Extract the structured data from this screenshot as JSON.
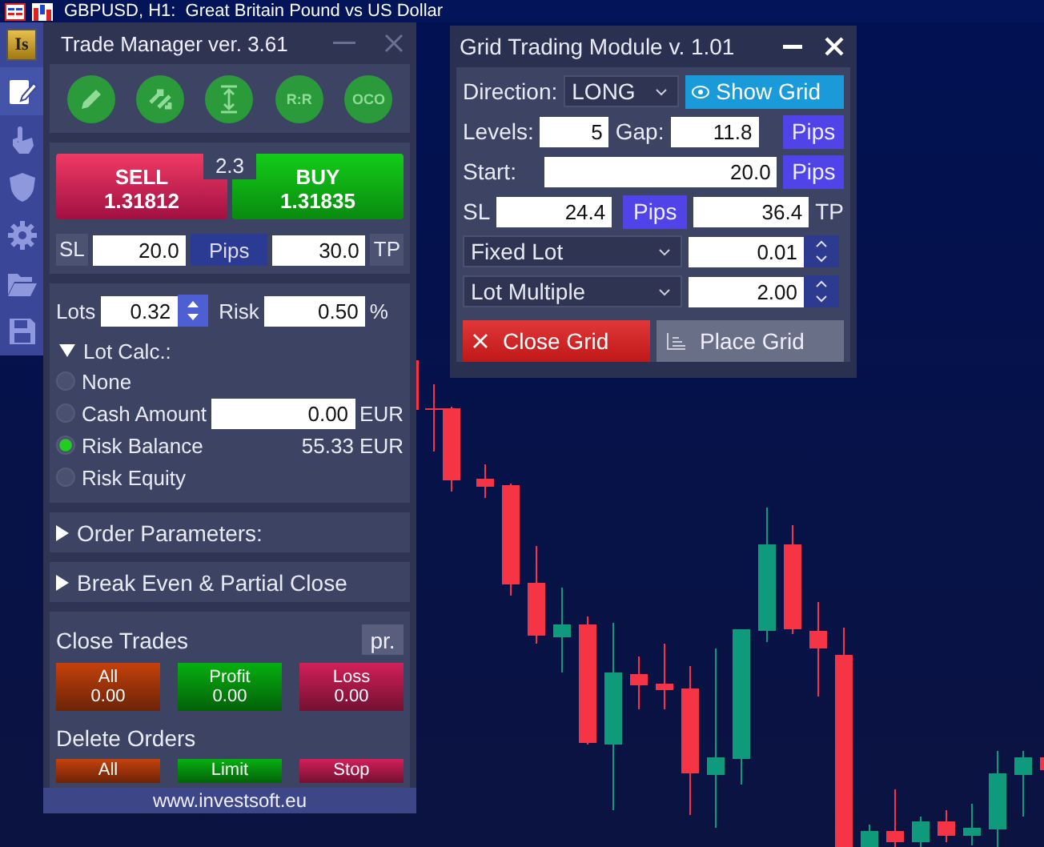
{
  "chart_window": {
    "title": "GBPUSD, H1:  Great Britain Pound vs US Dollar"
  },
  "sidebar": {
    "logo": "Is",
    "items": [
      {
        "selected": true
      },
      {
        "selected": false
      },
      {
        "selected": false
      },
      {
        "selected": false
      },
      {
        "selected": false
      },
      {
        "selected": false
      }
    ]
  },
  "trade_manager": {
    "title": "Trade Manager ver. 3.61",
    "tool_labels": [
      "R:R",
      "OCO"
    ],
    "sell": {
      "label": "SELL",
      "price": "1.31812"
    },
    "buy": {
      "label": "BUY",
      "price": "1.31835"
    },
    "spread": "2.3",
    "sl_label": "SL",
    "sl": "20.0",
    "pips": "Pips",
    "tp": "30.0",
    "tp_label": "TP",
    "lots_label": "Lots",
    "lots": "0.32",
    "risk_label": "Risk",
    "risk": "0.50",
    "risk_unit": "%",
    "lot_calc": {
      "label": "Lot Calc.:",
      "expanded": true,
      "options": [
        {
          "label": "None",
          "selected": false
        },
        {
          "label": "Cash Amount",
          "selected": false,
          "value": "0.00",
          "unit": "EUR"
        },
        {
          "label": "Risk Balance",
          "selected": true,
          "reading": "55.33 EUR"
        },
        {
          "label": "Risk Equity",
          "selected": false
        }
      ]
    },
    "sections": [
      {
        "label": "Order Parameters:",
        "expanded": false
      },
      {
        "label": "Break Even & Partial Close",
        "expanded": false
      }
    ],
    "close_trades": {
      "title": "Close Trades",
      "pr": "pr.",
      "buttons": [
        {
          "label": "All",
          "value": "0.00",
          "color": "#c5410c"
        },
        {
          "label": "Profit",
          "value": "0.00",
          "color": "#06b010"
        },
        {
          "label": "Loss",
          "value": "0.00",
          "color": "#d21f5a"
        }
      ]
    },
    "delete_orders": {
      "title": "Delete Orders",
      "buttons": [
        {
          "label": "All",
          "color": "#c5410c"
        },
        {
          "label": "Limit",
          "color": "#06b010"
        },
        {
          "label": "Stop",
          "color": "#d21f5a"
        }
      ]
    },
    "footer": "www.investsoft.eu"
  },
  "grid_module": {
    "title": "Grid Trading Module v. 1.01",
    "direction_label": "Direction:",
    "direction": "LONG",
    "show_grid": "Show Grid",
    "levels_label": "Levels:",
    "levels": "5",
    "gap_label": "Gap:",
    "gap": "11.8",
    "gap_unit": "Pips",
    "start_label": "Start:",
    "start": "20.0",
    "start_unit": "Pips",
    "sl_label": "SL",
    "sl": "24.4",
    "sl_unit": "Pips",
    "tp": "36.4",
    "tp_label": "TP",
    "lot_mode": "Fixed Lot",
    "lot": "0.01",
    "multiplier_mode": "Lot Multiple",
    "multiplier": "2.00",
    "close_grid": "Close Grid",
    "place_grid": "Place Grid"
  }
}
